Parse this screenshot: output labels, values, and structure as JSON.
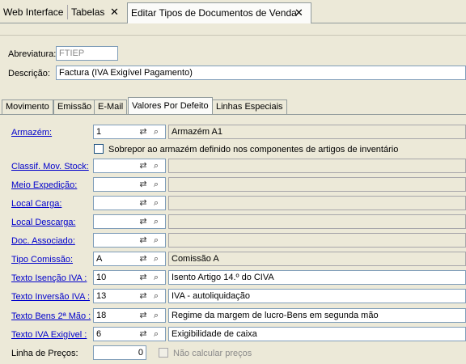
{
  "top_tabs": [
    {
      "label": "Web Interface"
    },
    {
      "label": "Tabelas",
      "close": "✕"
    },
    {
      "label": "Editar Tipos de Documentos de Venda",
      "close": "✕"
    }
  ],
  "form": {
    "abreviatura_label": "Abreviatura:",
    "abreviatura_value": "FTIEP",
    "descricao_label": "Descrição:",
    "descricao_value": "Factura (IVA Exigível Pagamento)"
  },
  "inner_tabs": [
    "Movimento",
    "Emissão",
    "E-Mail",
    "Valores Por Defeito",
    "Linhas Especiais"
  ],
  "fields": {
    "armazem": {
      "label": "Armazém:",
      "value": "1",
      "desc": "Armazém A1"
    },
    "sobrepor": {
      "label": "Sobrepor ao armazém definido nos componentes de artigos de inventário"
    },
    "classif": {
      "label": "Classif. Mov. Stock:",
      "value": "",
      "desc": ""
    },
    "meio": {
      "label": "Meio Expedição:",
      "value": "",
      "desc": ""
    },
    "local_carga": {
      "label": "Local Carga:",
      "value": "",
      "desc": ""
    },
    "local_descarga": {
      "label": "Local Descarga:",
      "value": "",
      "desc": ""
    },
    "doc_assoc": {
      "label": "Doc. Associado:",
      "value": "",
      "desc": ""
    },
    "tipo_comissao": {
      "label": "Tipo Comissão:",
      "value": "A",
      "desc": "Comissão A"
    },
    "texto_isencao": {
      "label": "Texto Isenção IVA :",
      "value": "10",
      "desc": "Isento Artigo 14.º do CIVA"
    },
    "texto_inversao": {
      "label": "Texto Inversão IVA :",
      "value": "13",
      "desc": "IVA - autoliquidação"
    },
    "texto_bens": {
      "label": "Texto Bens 2ª Mão :",
      "value": "18",
      "desc": "Regime da margem de lucro-Bens em segunda mão"
    },
    "texto_iva_exig": {
      "label": "Texto IVA Exigível :",
      "value": "6",
      "desc": "Exigibilidade de caixa"
    },
    "linha_precos": {
      "label": "Linha de Preços:",
      "value": "0"
    },
    "nao_calcular": {
      "label": "Não calcular preços"
    }
  },
  "icons": {
    "lookup_pair": "⇄",
    "search": "⌕"
  }
}
